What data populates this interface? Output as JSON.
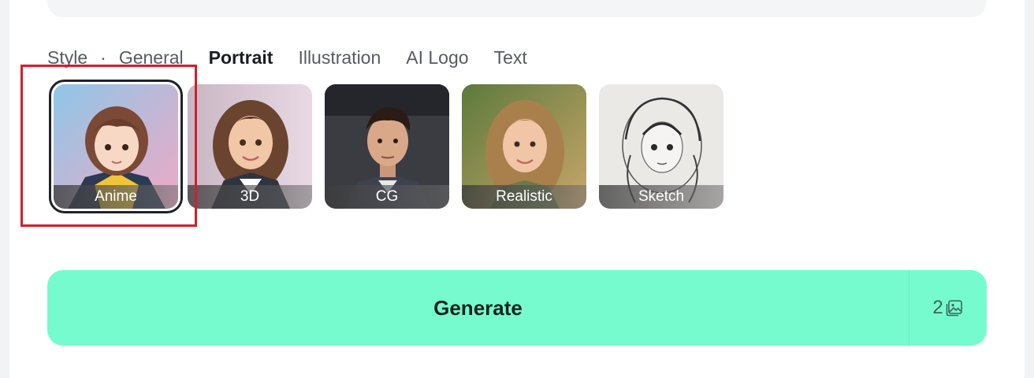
{
  "style_section": {
    "label": "Style",
    "separator": "·",
    "tabs": [
      {
        "label": "General",
        "active": false
      },
      {
        "label": "Portrait",
        "active": true
      },
      {
        "label": "Illustration",
        "active": false
      },
      {
        "label": "AI Logo",
        "active": false
      },
      {
        "label": "Text",
        "active": false
      }
    ]
  },
  "thumbnails": [
    {
      "label": "Anime",
      "selected": true
    },
    {
      "label": "3D",
      "selected": false
    },
    {
      "label": "CG",
      "selected": false
    },
    {
      "label": "Realistic",
      "selected": false
    },
    {
      "label": "Sketch",
      "selected": false
    }
  ],
  "generate": {
    "label": "Generate",
    "count": "2",
    "count_icon": "image-stack-icon"
  },
  "colors": {
    "generate_bg": "#76fbcf",
    "highlight": "#d21f2b"
  }
}
